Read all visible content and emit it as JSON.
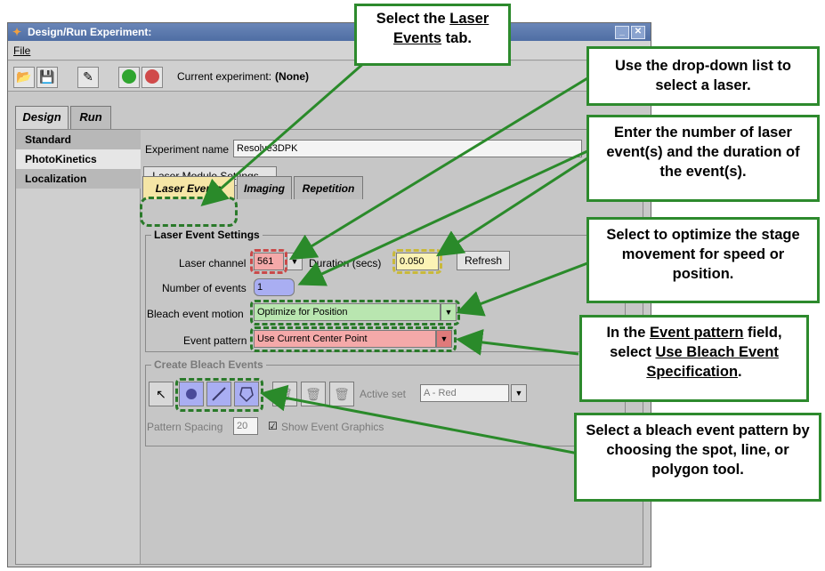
{
  "window": {
    "title": "Design/Run Experiment:",
    "menu_file": "File",
    "current_experiment_label": "Current experiment:",
    "current_experiment_value": "(None)"
  },
  "main_tabs": [
    "Design",
    "Run"
  ],
  "sidebar": {
    "items": [
      "Standard",
      "PhotoKinetics",
      "Localization"
    ]
  },
  "design": {
    "experiment_name_label": "Experiment name",
    "experiment_name_value": "Resolve3DPK",
    "laser_module_settings_button": "Laser Module Settings...",
    "sub_tabs": [
      "Laser Events",
      "Imaging",
      "Repetition"
    ],
    "laser_event_settings": {
      "group_title": "Laser Event Settings",
      "laser_channel_label": "Laser channel",
      "laser_channel_value": "561",
      "duration_label": "Duration (secs)",
      "duration_value": "0.050",
      "refresh_button": "Refresh",
      "number_of_events_label": "Number of events",
      "number_of_events_value": "1",
      "bleach_motion_label": "Bleach event motion",
      "bleach_motion_value": "Optimize for Position",
      "event_pattern_label": "Event pattern",
      "event_pattern_value": "Use Current Center Point"
    },
    "create_bleach_events": {
      "group_title": "Create Bleach Events",
      "active_set_label": "Active set",
      "active_set_value": "A - Red",
      "pattern_spacing_label": "Pattern Spacing",
      "pattern_spacing_value": "20",
      "show_event_graphics_label": "Show Event Graphics"
    }
  },
  "callouts": {
    "c1": {
      "pre": "Select the ",
      "u": "Laser Events",
      "post": " tab."
    },
    "c2": "Use the drop-down list to select a laser.",
    "c3": "Enter the number of laser event(s) and the duration of the event(s).",
    "c4": "Select to optimize the stage movement for speed or position.",
    "c5": {
      "pre": "In the ",
      "u1": "Event pattern",
      "mid": " field, select ",
      "u2": "Use Bleach Event Specification",
      "post": "."
    },
    "c6": "Select a bleach event pattern by choosing the spot, line, or polygon tool."
  },
  "colors": {
    "callout_border": "#2d8a2d",
    "arrow": "#2a8a2a",
    "red_highlight": "#f4a9a9",
    "yellow_highlight": "#fbf3b5",
    "blue_highlight": "#a9aef2",
    "green_highlight": "#b9e6b0"
  }
}
